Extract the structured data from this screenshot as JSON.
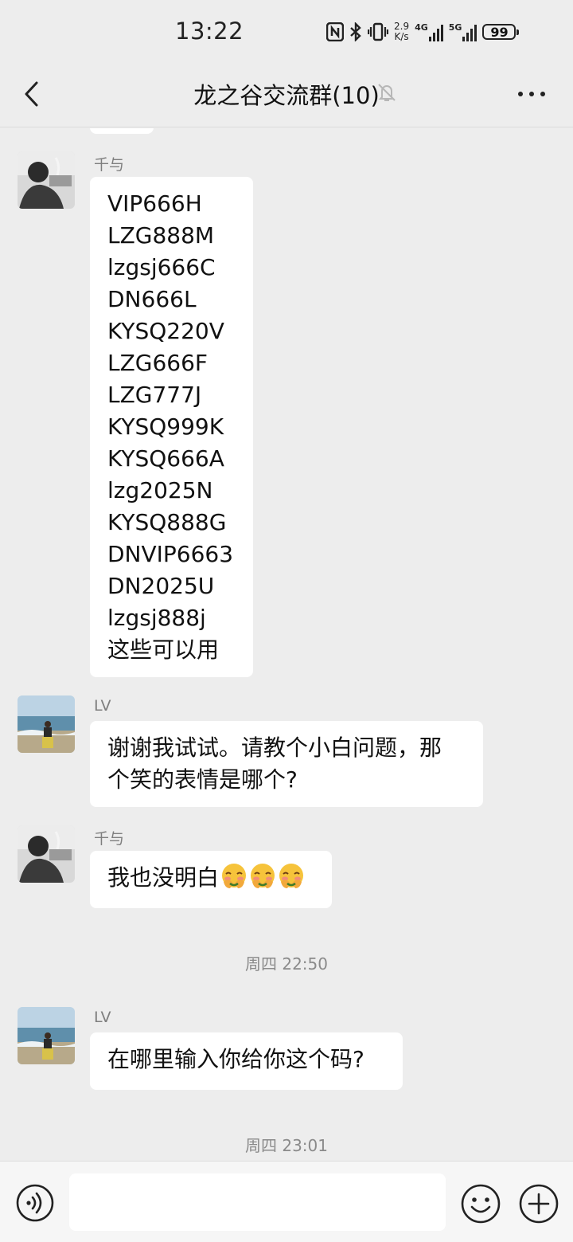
{
  "status_bar": {
    "time": "13:22",
    "nfc": "N",
    "net_speed_value": "2.9",
    "net_speed_unit": "K/s",
    "sim1_label": "4G",
    "sim2_label": "5G",
    "battery": "99"
  },
  "header": {
    "title": "龙之谷交流群(10)",
    "icons": [
      "back-arrow-icon",
      "mute-bell-icon",
      "more-dots-icon"
    ]
  },
  "messages": [
    {
      "sender": "千与",
      "lines": [
        "VIP666H",
        "LZG888M",
        "lzgsj666C",
        "DN666L",
        "KYSQ220V",
        "LZG666F",
        "LZG777J",
        "KYSQ999K",
        "KYSQ666A",
        "lzg2025N",
        "KYSQ888G",
        "DNVIP6663",
        "DN2025U",
        "lzgsj888j",
        "这些可以用"
      ]
    },
    {
      "sender": "LV",
      "lines": [
        "谢谢我试试。请教个小白问题，那",
        "个笑的表情是哪个?"
      ]
    },
    {
      "sender": "千与",
      "text": "我也没明白",
      "emoji": "facepalm-smile-emoji"
    },
    {
      "timestamp": "周四 22:50"
    },
    {
      "sender": "LV",
      "text": "在哪里输入你给你这个码?"
    },
    {
      "timestamp": "周四 23:01"
    }
  ],
  "input_bar": {
    "placeholder": "",
    "icons": [
      "voice-icon",
      "emoji-icon",
      "plus-icon"
    ]
  },
  "colors": {
    "background": "#ededed",
    "bubble": "#ffffff",
    "sender_name": "#7e7e7e",
    "timestamp": "#8a8a8a"
  }
}
